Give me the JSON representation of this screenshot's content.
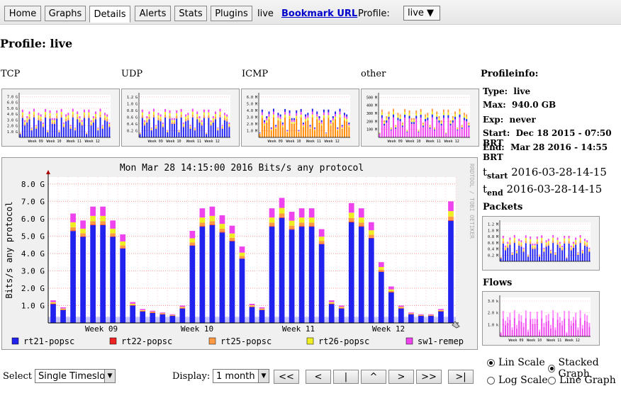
{
  "nav": {
    "tabs": [
      "Home",
      "Graphs",
      "Details",
      "Alerts",
      "Stats",
      "Plugins"
    ],
    "active": "Details",
    "profile_name": "live",
    "bookmark": "Bookmark URL",
    "profile_label": "Profile:",
    "profile_select": "live ▼"
  },
  "page_title": "Profile: live",
  "categories": [
    "TCP",
    "UDP",
    "ICMP",
    "other"
  ],
  "profileinfo": {
    "title": "Profileinfo:",
    "rows": [
      {
        "k": "Type:",
        "v": "live"
      },
      {
        "k": "Max:",
        "v": "940.0 GB"
      },
      {
        "k": "Exp:",
        "v": "never"
      },
      {
        "k": "Start:",
        "v": "Dec 18 2015 - 07:50 BRT"
      },
      {
        "k": "End:",
        "v": "Mar 28 2016 - 14:55 BRT"
      }
    ]
  },
  "tstart": {
    "label": "t",
    "sub": "start",
    "value": "2016-03-28-14-15"
  },
  "tend": {
    "label": "t",
    "sub": "end",
    "value": "2016-03-28-14-15"
  },
  "packets_label": "Packets",
  "flows_label": "Flows",
  "controls": {
    "select_label": "Select",
    "select_value": "Single Timeslot",
    "display_label": "Display:",
    "display_value": "1 month",
    "buttons": [
      "<<",
      "<",
      "|",
      "^",
      ">",
      ">>",
      ">|"
    ],
    "lin_scale": "Lin Scale",
    "log_scale": "Log Scale",
    "stacked": "Stacked Graph",
    "line_graph": "Line Graph"
  },
  "chart_data": [
    {
      "type": "area",
      "title": "Mon Mar 28 14:15:00 2016 Bits/s any protocol",
      "ylabel": "Bits/s any protocol",
      "watermark": "RRDTOOL / TOBI OETIKER",
      "ylim": [
        0,
        8.4
      ],
      "yticks": [
        "1.0 G",
        "2.0 G",
        "3.0 G",
        "4.0 G",
        "5.0 G",
        "6.0 G",
        "7.0 G",
        "8.0 G"
      ],
      "xticks": [
        "Week 09",
        "Week 10",
        "Week 11",
        "Week 12"
      ],
      "series": [
        {
          "name": "rt21-popsc",
          "color": "#2222ee"
        },
        {
          "name": "rt22-popsc",
          "color": "#ee2222"
        },
        {
          "name": "rt25-popsc",
          "color": "#ff9944"
        },
        {
          "name": "rt26-popsc",
          "color": "#eeee22"
        },
        {
          "name": "sw1-remep",
          "color": "#ee44ee"
        }
      ],
      "peaks": [
        1.3,
        0.9,
        6.3,
        5.9,
        6.7,
        6.7,
        5.9,
        5.1,
        1.2,
        0.8,
        0.7,
        0.6,
        0.5,
        1.0,
        5.3,
        6.6,
        6.7,
        6.2,
        5.6,
        4.4,
        1.1,
        0.9,
        6.6,
        7.2,
        6.4,
        6.6,
        6.6,
        5.4,
        1.3,
        1.0,
        6.9,
        6.6,
        5.8,
        3.5,
        2.1,
        1.0,
        0.6,
        0.5,
        0.5,
        0.8,
        7.0
      ]
    },
    {
      "type": "area",
      "label": "TCP",
      "yticks": [
        "1.0 G",
        "2.0 G",
        "3.0 G",
        "4.0 G",
        "5.0 G",
        "6.0 G",
        "7.0 G"
      ]
    },
    {
      "type": "area",
      "label": "UDP",
      "yticks": [
        "0.2 G",
        "0.4 G",
        "0.6 G",
        "0.8 G",
        "1.0 G",
        "1.2 G"
      ]
    },
    {
      "type": "area",
      "label": "ICMP",
      "yticks": [
        "1.0 M",
        "2.0 M",
        "3.0 M",
        "4.0 M",
        "5.0 M",
        "6.0 M"
      ]
    },
    {
      "type": "area",
      "label": "other",
      "yticks": [
        "100 M",
        "200 M",
        "300 M",
        "400 M",
        "500 M"
      ]
    },
    {
      "type": "area",
      "label": "Packets",
      "yticks": [
        "0.2 M",
        "0.4 M",
        "0.6 M",
        "0.8 M",
        "1.0 M",
        "1.2 M"
      ]
    },
    {
      "type": "area",
      "label": "Flows",
      "yticks": [
        "1.0 k",
        "2.0 k",
        "3.0 k"
      ]
    }
  ]
}
